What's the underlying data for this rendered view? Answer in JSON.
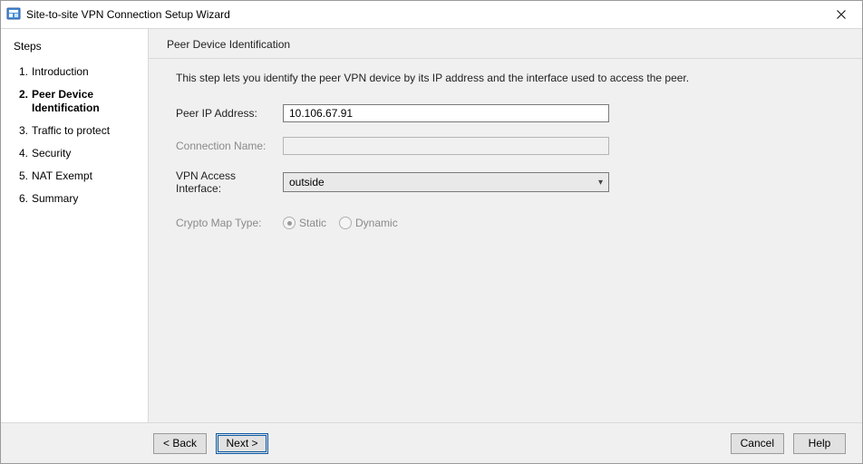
{
  "window": {
    "title": "Site-to-site VPN Connection Setup Wizard"
  },
  "sidebar": {
    "heading": "Steps",
    "items": [
      {
        "num": "1.",
        "label": "Introduction"
      },
      {
        "num": "2.",
        "label": "Peer Device Identification"
      },
      {
        "num": "3.",
        "label": "Traffic to protect"
      },
      {
        "num": "4.",
        "label": "Security"
      },
      {
        "num": "5.",
        "label": "NAT Exempt"
      },
      {
        "num": "6.",
        "label": "Summary"
      }
    ],
    "current_index": 1
  },
  "content": {
    "header": "Peer Device Identification",
    "description": "This step lets you identify the peer VPN device by its IP address and the interface used to access the peer.",
    "peer_ip_label": "Peer IP Address:",
    "peer_ip_value": "10.106.67.91",
    "conn_name_label": "Connection Name:",
    "conn_name_value": "",
    "iface_label": "VPN Access Interface:",
    "iface_value": "outside",
    "crypto_label": "Crypto Map Type:",
    "crypto_options": {
      "static": "Static",
      "dynamic": "Dynamic"
    },
    "crypto_selected": "static"
  },
  "footer": {
    "back": "< Back",
    "next": "Next >",
    "cancel": "Cancel",
    "help": "Help"
  }
}
